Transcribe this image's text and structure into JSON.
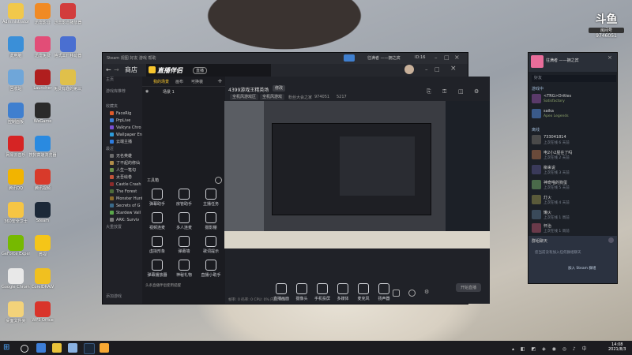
{
  "desktop": {
    "icons": [
      {
        "label": "Administrator",
        "color": "#f1c84b"
      },
      {
        "label": "迅雷影音",
        "color": "#f08a24"
      },
      {
        "label": "迅雷影音播放器",
        "color": "#d23c3c"
      },
      {
        "label": "此电脑",
        "color": "#3a8fd8"
      },
      {
        "label": "迅雷免费",
        "color": "#e24d77"
      },
      {
        "label": "格式工厂移动器",
        "color": "#4a6fd1"
      },
      {
        "label": "回收站",
        "color": "#6fa6d9"
      },
      {
        "label": "Launcher",
        "color": "#b01e1e"
      },
      {
        "label": "免费有趣的第三方工具",
        "color": "#e0c04a"
      },
      {
        "label": "控制面板",
        "color": "#3f7fcf"
      },
      {
        "label": "WeGame",
        "color": "#2a2a2a"
      },
      {
        "label": "网易云音乐",
        "color": "#d62424"
      },
      {
        "label": "搜狗高速浏览器",
        "color": "#2a8ae0"
      },
      {
        "label": "腾讯QQ",
        "color": "#f2b400"
      },
      {
        "label": "腾讯视频",
        "color": "#d83a2a"
      },
      {
        "label": "360安全卫士",
        "color": "#f6c544"
      },
      {
        "label": "Steam",
        "color": "#1b2838"
      },
      {
        "label": "GeForce Experience",
        "color": "#76b900"
      },
      {
        "label": "微视",
        "color": "#f5c518"
      },
      {
        "label": "Google Chrome",
        "color": "#e8e8e8"
      },
      {
        "label": "CorelDRAW",
        "color": "#f0c020"
      },
      {
        "label": "桌面文件夹",
        "color": "#f3d27a"
      },
      {
        "label": "WPS Office",
        "color": "#d9342b"
      }
    ]
  },
  "app": {
    "title": "直播伴侣",
    "tab_label": "商店",
    "topbar_user": "往满者 ——拥之宾",
    "topbar_id": "ID:16",
    "badge": "直播",
    "nav": {
      "sections": [
        "主页",
        "游戏库推荐",
        "收藏夹",
        "最近"
      ],
      "items": [
        "FaceRig",
        "PrpLive",
        "Valkyra Chro",
        "Wallpaper En",
        "云端主播",
        "无名英雄",
        "了不起的修仙",
        "人生一笔勾",
        "太吾绘卷",
        "Castle Crash",
        "The Forest",
        "Monster Hunt",
        "Secrets of G",
        "Stardew Vall",
        "ARK: Surviv"
      ],
      "section2": [
        "大重放置",
        "最新"
      ],
      "footer": "添加游戏"
    },
    "overlay": {
      "tabs": [
        "我的场景",
        "画布",
        "可换装"
      ],
      "scene_label": "场景 1",
      "toolbox_title": "工具箱",
      "tools": [
        "弹幕助手",
        "房管助手",
        "主播任务",
        "视频连麦",
        "多人连麦",
        "摄影棚",
        "虚拟形象",
        "弹幕墙",
        "歌词提示",
        "弹幕播放器",
        "神秘礼物",
        "直播小助手"
      ],
      "notice": "头条直播伴侣使用提醒"
    },
    "stream": {
      "title": "4399游戏王精英场",
      "edit_label": "修改",
      "tag1": "全机风游戏区",
      "tag2": "全机风游戏",
      "status": "粉丝大会之家",
      "fans": "974051",
      "likes": "5217"
    },
    "bottom_tools": [
      "直播画面",
      "摄像头",
      "手机投屏",
      "多媒体",
      "麦克风",
      "扬声器"
    ],
    "start_btn": "开始直播",
    "footer_text": "频道数据 0/0",
    "footer_right": "帧率: 0  码率: 0  CPU: 0%  内存: 0%"
  },
  "chat": {
    "owner": "往满者 ——拥之宾",
    "search": "好友",
    "groups": [
      "游戏中",
      "离线"
    ],
    "contacts": [
      {
        "name": "<TRG>Dritles",
        "status": "Satisfactory"
      },
      {
        "name": "saika",
        "status": "Apex Legends"
      },
      {
        "name": "733041814",
        "status": "上次在线 6 天前"
      },
      {
        "name": "电2小2屋在了吗",
        "status": "上次在线 2 天前"
      },
      {
        "name": "柳来说",
        "status": "上次在线 3 天前"
      },
      {
        "name": "神奇喵的狗蛋",
        "status": "上次在线 5 天前"
      },
      {
        "name": "灯火",
        "status": "上次在线 4 天前"
      },
      {
        "name": "懒火",
        "status": "上次在线 1 周前"
      },
      {
        "name": "怀治",
        "status": "上次在线 1 周前"
      }
    ],
    "group_chat_title": "群组聊天",
    "group_chat_desc": "您当前没有加入任何群组聊天",
    "group_chat_link": "加入 Steam 群组"
  },
  "logo": {
    "text": "斗鱼",
    "sub": "房间号",
    "num": "9746051"
  },
  "taskbar": {
    "time": "14:08",
    "date": "2021/8/3"
  }
}
